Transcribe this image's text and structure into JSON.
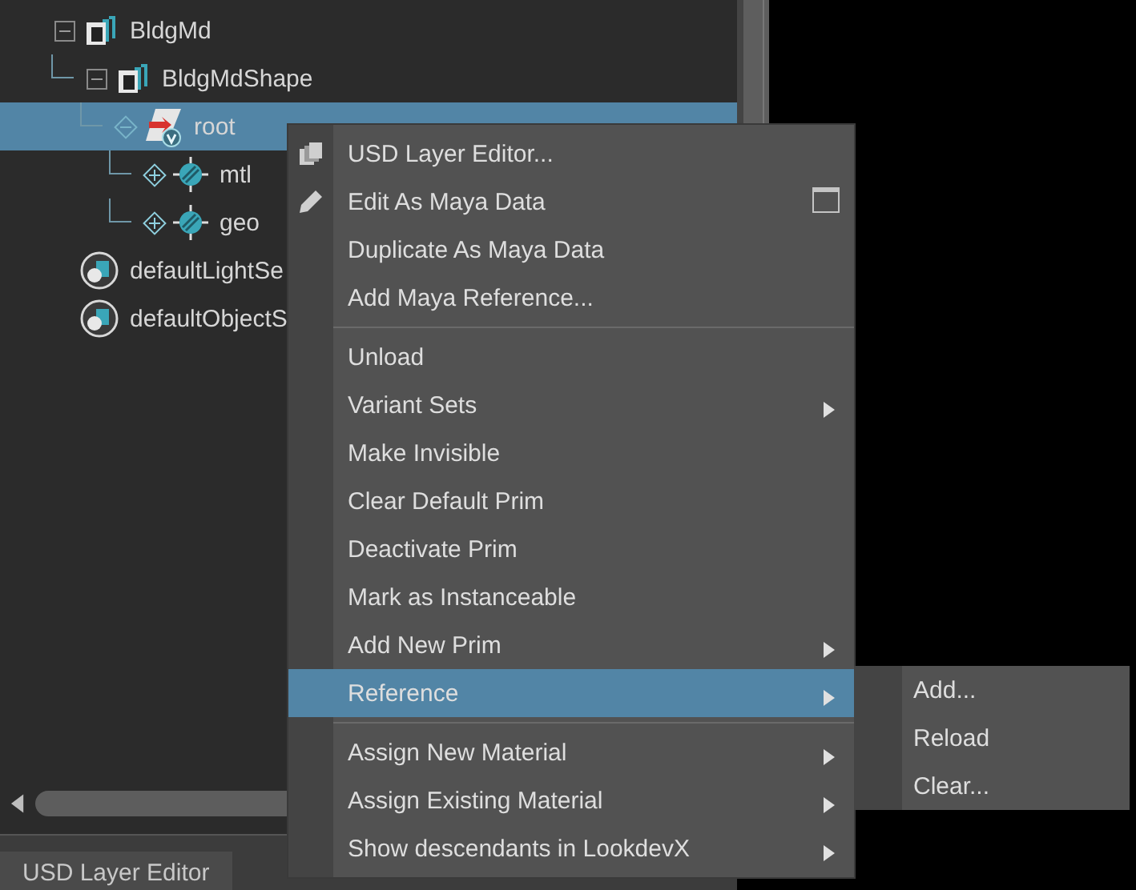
{
  "outliner": {
    "nodes": [
      {
        "label": "BldgMd",
        "kind": "transform",
        "expanded": true,
        "selected": false,
        "children": [
          {
            "label": "BldgMdShape",
            "kind": "shape",
            "expanded": true,
            "selected": false,
            "children": [
              {
                "label": "root",
                "kind": "prim",
                "expanded": true,
                "selected": true,
                "children": [
                  {
                    "label": "mtl",
                    "kind": "scope",
                    "expanded": false,
                    "selected": false
                  },
                  {
                    "label": "geo",
                    "kind": "scope",
                    "expanded": false,
                    "selected": false
                  }
                ]
              }
            ]
          }
        ]
      },
      {
        "label": "defaultLightSe",
        "kind": "set",
        "selected": false
      },
      {
        "label": "defaultObjectS",
        "kind": "set",
        "selected": false
      }
    ]
  },
  "bottom_tab": {
    "label": "USD Layer Editor"
  },
  "context_menu": {
    "sections": [
      {
        "items": [
          {
            "label": "USD Layer Editor...",
            "kind": "layers",
            "submenu": false,
            "option_box": false,
            "selected": false
          },
          {
            "label": "Edit As Maya Data",
            "kind": "pencil",
            "submenu": false,
            "option_box": true,
            "selected": false
          },
          {
            "label": "Duplicate As Maya Data",
            "kind": "plain",
            "submenu": false,
            "option_box": false,
            "selected": false
          },
          {
            "label": "Add Maya Reference...",
            "kind": "plain",
            "submenu": false,
            "option_box": false,
            "selected": false
          }
        ]
      },
      {
        "items": [
          {
            "label": "Unload",
            "kind": "plain",
            "submenu": false,
            "option_box": false,
            "selected": false
          },
          {
            "label": "Variant Sets",
            "kind": "plain",
            "submenu": true,
            "option_box": false,
            "selected": false
          },
          {
            "label": "Make Invisible",
            "kind": "plain",
            "submenu": false,
            "option_box": false,
            "selected": false
          },
          {
            "label": "Clear Default Prim",
            "kind": "plain",
            "submenu": false,
            "option_box": false,
            "selected": false
          },
          {
            "label": "Deactivate Prim",
            "kind": "plain",
            "submenu": false,
            "option_box": false,
            "selected": false
          },
          {
            "label": "Mark as Instanceable",
            "kind": "plain",
            "submenu": false,
            "option_box": false,
            "selected": false
          },
          {
            "label": "Add New Prim",
            "kind": "plain",
            "submenu": true,
            "option_box": false,
            "selected": false
          },
          {
            "label": "Reference",
            "kind": "plain",
            "submenu": true,
            "option_box": false,
            "selected": true
          }
        ]
      },
      {
        "items": [
          {
            "label": "Assign New Material",
            "kind": "plain",
            "submenu": true,
            "option_box": false,
            "selected": false
          },
          {
            "label": "Assign Existing Material",
            "kind": "plain",
            "submenu": true,
            "option_box": false,
            "selected": false
          },
          {
            "label": "Show descendants in LookdevX",
            "kind": "plain",
            "submenu": true,
            "option_box": false,
            "selected": false
          }
        ]
      }
    ]
  },
  "submenu": {
    "items": [
      {
        "label": "Add..."
      },
      {
        "label": "Reload"
      },
      {
        "label": "Clear..."
      }
    ]
  }
}
